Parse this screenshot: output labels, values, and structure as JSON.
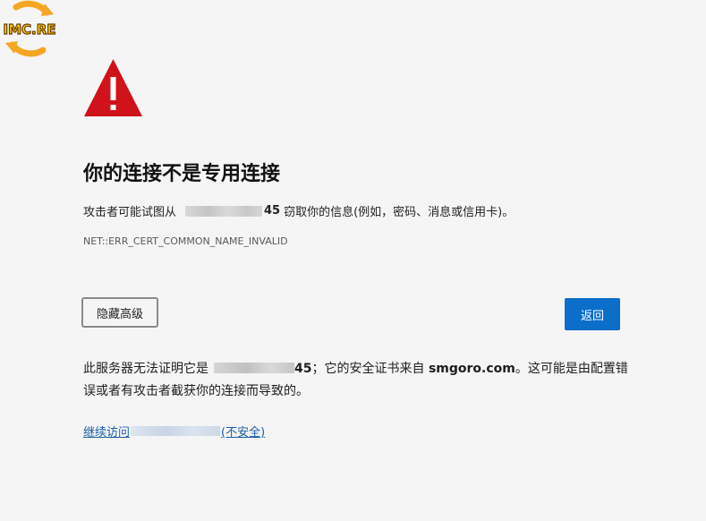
{
  "logo": {
    "text": "IMC.RE",
    "icon": "imc-re-logo"
  },
  "warning": {
    "icon": "warning-triangle-icon",
    "color": "#d0121b"
  },
  "title": "你的连接不是专用连接",
  "description": {
    "prefix": "攻击者可能试图从",
    "redacted_tail": "45",
    "suffix": "窃取你的信息(例如，密码、消息或信用卡)。"
  },
  "error_code": "NET::ERR_CERT_COMMON_NAME_INVALID",
  "buttons": {
    "advanced": "隐藏高级",
    "back": "返回"
  },
  "detail": {
    "part1": "此服务器无法证明它是",
    "redacted_tail": "45",
    "part2": "；它的安全证书来自",
    "domain": "smgoro.com",
    "part3": "。这可能是由配置错误或者有攻击者截获你的连接而导致的。"
  },
  "continue_link": {
    "prefix": "继续访问",
    "suffix": "(不安全)"
  },
  "colors": {
    "background": "#f5f5f5",
    "primary_button": "#0b6fca",
    "link": "#1a5fa8"
  }
}
